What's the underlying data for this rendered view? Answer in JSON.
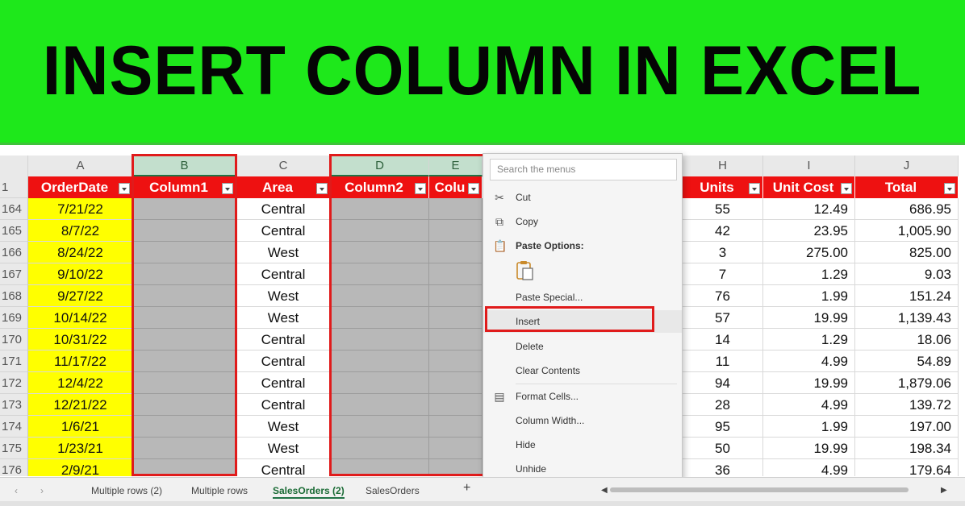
{
  "banner": {
    "title": "INSERT COLUMN IN EXCEL",
    "bg_color": "#1ee81b"
  },
  "columns": [
    "A",
    "B",
    "C",
    "D",
    "E",
    "H",
    "I",
    "J"
  ],
  "headers": {
    "order_date": "OrderDate",
    "column1": "Column1",
    "area": "Area",
    "column2": "Column2",
    "column3_partial": "Colu",
    "units": "Units",
    "unit_cost": "Unit Cost",
    "total": "Total"
  },
  "rows": [
    {
      "num": "164",
      "date": "7/21/22",
      "area": "Central",
      "units": "55",
      "unit_cost": "12.49",
      "total": "686.95"
    },
    {
      "num": "165",
      "date": "8/7/22",
      "area": "Central",
      "units": "42",
      "unit_cost": "23.95",
      "total": "1,005.90"
    },
    {
      "num": "166",
      "date": "8/24/22",
      "area": "West",
      "units": "3",
      "unit_cost": "275.00",
      "total": "825.00"
    },
    {
      "num": "167",
      "date": "9/10/22",
      "area": "Central",
      "units": "7",
      "unit_cost": "1.29",
      "total": "9.03"
    },
    {
      "num": "168",
      "date": "9/27/22",
      "area": "West",
      "units": "76",
      "unit_cost": "1.99",
      "total": "151.24"
    },
    {
      "num": "169",
      "date": "10/14/22",
      "area": "West",
      "units": "57",
      "unit_cost": "19.99",
      "total": "1,139.43"
    },
    {
      "num": "170",
      "date": "10/31/22",
      "area": "Central",
      "units": "14",
      "unit_cost": "1.29",
      "total": "18.06"
    },
    {
      "num": "171",
      "date": "11/17/22",
      "area": "Central",
      "units": "11",
      "unit_cost": "4.99",
      "total": "54.89"
    },
    {
      "num": "172",
      "date": "12/4/22",
      "area": "Central",
      "units": "94",
      "unit_cost": "19.99",
      "total": "1,879.06"
    },
    {
      "num": "173",
      "date": "12/21/22",
      "area": "Central",
      "units": "28",
      "unit_cost": "4.99",
      "total": "139.72"
    },
    {
      "num": "174",
      "date": "1/6/21",
      "area": "West",
      "units": "95",
      "unit_cost": "1.99",
      "total": "197.00"
    },
    {
      "num": "175",
      "date": "1/23/21",
      "area": "West",
      "units": "50",
      "unit_cost": "19.99",
      "total": "198.34"
    },
    {
      "num": "176",
      "date": "2/9/21",
      "area": "Central",
      "units": "36",
      "unit_cost": "4.99",
      "total": "179.64"
    }
  ],
  "header_row_num": "1",
  "context_menu": {
    "search_placeholder": "Search the menus",
    "cut": "Cut",
    "copy": "Copy",
    "paste_options": "Paste Options:",
    "paste_special": "Paste Special...",
    "insert": "Insert",
    "delete": "Delete",
    "clear_contents": "Clear Contents",
    "format_cells": "Format Cells...",
    "column_width": "Column Width...",
    "hide": "Hide",
    "unhide": "Unhide"
  },
  "tabs": [
    "Multiple rows (2)",
    "Multiple rows",
    "SalesOrders (2)",
    "SalesOrders"
  ],
  "active_tab": "SalesOrders (2)",
  "colors": {
    "header_red": "#ee1111",
    "date_yellow": "#ffff00",
    "highlight_red": "#e01b1b",
    "selected_gray": "#b8b8b8"
  }
}
